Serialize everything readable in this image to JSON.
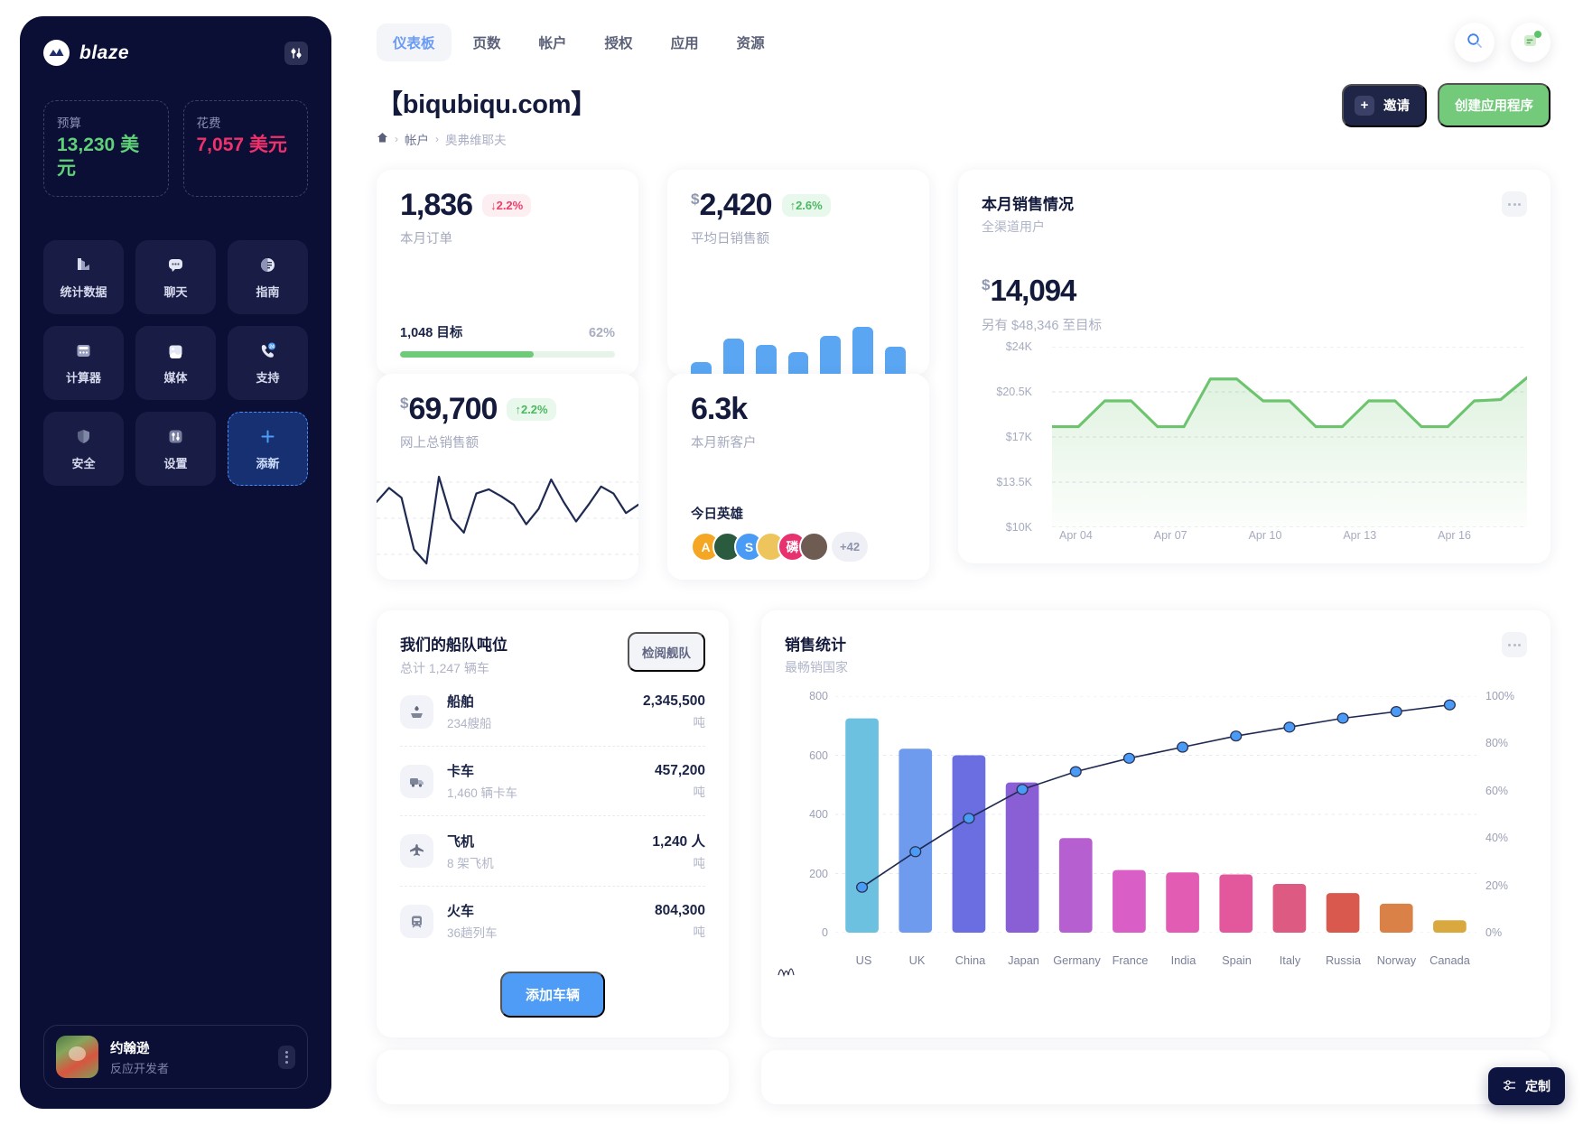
{
  "sidebar": {
    "brand": "blaze",
    "tool_icon": "sliders-icon",
    "kpis": [
      {
        "label": "预算",
        "value": "13,230 美元",
        "color": "#5fd177",
        "name": "budget"
      },
      {
        "label": "花费",
        "value": "7,057 美元",
        "color": "#f0316b",
        "name": "spent"
      }
    ],
    "tiles": [
      {
        "label": "统计数据",
        "icon": "chart-icon"
      },
      {
        "label": "聊天",
        "icon": "chat-icon"
      },
      {
        "label": "指南",
        "icon": "guide-icon"
      },
      {
        "label": "计算器",
        "icon": "calculator-icon"
      },
      {
        "label": "媒体",
        "icon": "media-icon"
      },
      {
        "label": "支持",
        "icon": "support-24-icon"
      },
      {
        "label": "安全",
        "icon": "shield-icon"
      },
      {
        "label": "设置",
        "icon": "settings-icon"
      },
      {
        "label": "添新",
        "icon": "plus-icon"
      }
    ],
    "profile": {
      "name": "约翰逊",
      "role": "反应开发者"
    }
  },
  "topbar": {
    "tabs": [
      {
        "label": "仪表板",
        "active": true
      },
      {
        "label": "页数",
        "active": false
      },
      {
        "label": "帐户",
        "active": false
      },
      {
        "label": "授权",
        "active": false
      },
      {
        "label": "应用",
        "active": false
      },
      {
        "label": "资源",
        "active": false
      }
    ],
    "search_icon": "search-icon",
    "notes_icon": "note-icon"
  },
  "header": {
    "title": "【biqubiqu.com】",
    "breadcrumb": {
      "home": "home-icon",
      "level1": "帐户",
      "level2": "奥弗维耶夫"
    },
    "invite_label": "邀请",
    "create_label": "创建应用程序"
  },
  "cards": {
    "orders": {
      "value": "1,836",
      "delta": "2.2%",
      "delta_dir": "down",
      "subtitle": "本月订单",
      "goal_label": "1,048 目标",
      "goal_pct_label": "62%",
      "goal_pct": 62
    },
    "avg_daily": {
      "currency": "$",
      "value": "2,420",
      "delta": "2.6%",
      "delta_dir": "up",
      "subtitle": "平均日销售额"
    },
    "online_total": {
      "currency": "$",
      "value": "69,700",
      "delta": "2.2%",
      "delta_dir": "up",
      "subtitle": "网上总销售额"
    },
    "new_customers": {
      "value": "6.3k",
      "subtitle": "本月新客户",
      "heroes_title": "今日英雄",
      "heroes": [
        {
          "initial": "A",
          "color": "#f5a623"
        },
        {
          "initial": "",
          "color": "#2a5b3f"
        },
        {
          "initial": "S",
          "color": "#4a9bf5"
        },
        {
          "initial": "",
          "color": "#edc55c"
        },
        {
          "initial": "磷",
          "color": "#e8316f"
        },
        {
          "initial": "",
          "color": "#6e5b52"
        }
      ],
      "heroes_more": "+42"
    },
    "monthly_sales": {
      "title": "本月销售情况",
      "subtitle": "全渠道用户",
      "currency": "$",
      "value": "14,094",
      "note": "另有 $48,346 至目标"
    },
    "fleet": {
      "title": "我们的船队吨位",
      "subtitle": "总计 1,247 辆车",
      "review_label": "检阅舰队",
      "add_label": "添加车辆",
      "items": [
        {
          "icon": "ship-icon",
          "name": "船舶",
          "meta": "234艘船",
          "value": "2,345,500",
          "unit": "吨"
        },
        {
          "icon": "truck-icon",
          "name": "卡车",
          "meta": "1,460 辆卡车",
          "value": "457,200",
          "unit": "吨"
        },
        {
          "icon": "plane-icon",
          "name": "飞机",
          "meta": "8 架飞机",
          "value": "1,240 人",
          "unit": "吨"
        },
        {
          "icon": "train-icon",
          "name": "火车",
          "meta": "36趟列车",
          "value": "804,300",
          "unit": "吨"
        }
      ]
    },
    "sales_stats": {
      "title": "销售统计",
      "subtitle": "最畅销国家"
    }
  },
  "customize": {
    "label": "定制",
    "icon": "sliders-icon"
  },
  "chart_data": [
    {
      "type": "area",
      "name": "monthly-sales-line",
      "title": "本月销售情况",
      "subtitle": "全渠道用户",
      "xlabel": "",
      "ylabel": "",
      "ylim": [
        10000,
        24000
      ],
      "ytick_labels": [
        "$24K",
        "$20.5K",
        "$17K",
        "$13.5K",
        "$10K"
      ],
      "yticks": [
        24000,
        20500,
        17000,
        13500,
        10000
      ],
      "xtick_labels": [
        "Apr 04",
        "Apr 07",
        "Apr 10",
        "Apr 13",
        "Apr 16"
      ],
      "grid": true,
      "line_color": "#6cc46e",
      "values": [
        17800,
        17800,
        19800,
        19800,
        17800,
        17800,
        21500,
        21500,
        19800,
        19800,
        17800,
        17800,
        19800,
        19800,
        17800,
        17800,
        19800,
        19900,
        21600
      ]
    },
    {
      "type": "bar",
      "name": "avg-daily-sales-minibars",
      "title": "平均日销售额",
      "values": [
        22,
        62,
        52,
        40,
        66,
        82,
        48
      ],
      "bar_color": "#5aa6f2"
    },
    {
      "type": "bar",
      "name": "sales-statistics-pareto",
      "title": "销售统计",
      "subtitle": "最畅销国家",
      "categories": [
        "US",
        "UK",
        "China",
        "Japan",
        "Germany",
        "France",
        "India",
        "Spain",
        "Italy",
        "Russia",
        "Norway",
        "Canada"
      ],
      "values": [
        725,
        622,
        600,
        508,
        320,
        212,
        204,
        197,
        165,
        134,
        98,
        42
      ],
      "ylabel": "",
      "ylim": [
        0,
        800
      ],
      "ytick_labels": [
        "800",
        "600",
        "400",
        "200",
        "0"
      ],
      "yticks": [
        800,
        600,
        400,
        200,
        0
      ],
      "secondary_axis": {
        "name": "cumulative",
        "ytick_labels": [
          "100%",
          "80%",
          "60%",
          "40%",
          "20%",
          "0%"
        ],
        "yticks": [
          100,
          80,
          60,
          40,
          20,
          0
        ],
        "values": [
          18,
          34,
          49,
          62,
          70,
          76,
          81,
          86,
          90,
          94,
          97,
          100
        ],
        "line_color": "#1f2a52",
        "marker_color": "#4a9bf5"
      },
      "bar_colors": [
        "#6cc0e0",
        "#6f9bef",
        "#6a6ee0",
        "#8a5fd6",
        "#b55fd0",
        "#d95fc6",
        "#e35cb4",
        "#e3589c",
        "#dd5a83",
        "#d9594f",
        "#d98146",
        "#d9a93f"
      ],
      "grid": true
    },
    {
      "type": "line",
      "name": "online-total-sales-sparkline",
      "title": "网上总销售额",
      "line_color": "#1f2a52",
      "values": [
        52,
        62,
        55,
        18,
        8,
        70,
        40,
        30,
        58,
        61,
        56,
        50,
        36,
        47,
        68,
        52,
        38,
        50,
        63,
        58,
        44,
        50
      ]
    }
  ]
}
